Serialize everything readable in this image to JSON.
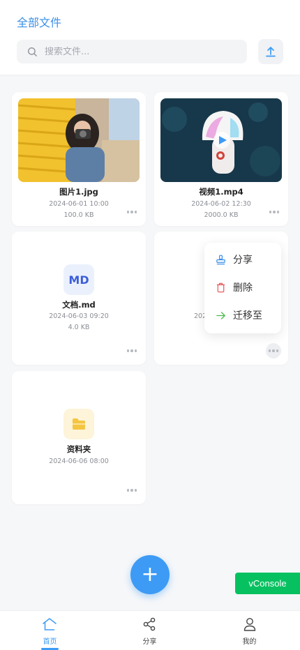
{
  "header": {
    "title": "全部文件",
    "search_placeholder": "搜索文件..."
  },
  "files": [
    {
      "name": "图片1.jpg",
      "date": "2024-06-01 10:00",
      "size": "100.0 KB",
      "type": "image"
    },
    {
      "name": "视频1.mp4",
      "date": "2024-06-02 12:30",
      "size": "2000.0 KB",
      "type": "video"
    },
    {
      "name": "文档.md",
      "date": "2024-06-03 09:20",
      "size": "4.0 KB",
      "type": "markdown",
      "icon_text": "MD"
    },
    {
      "name": "",
      "date": "202",
      "size": "",
      "type": "unknown"
    },
    {
      "name": "资料夹",
      "date": "2024-06-06 08:00",
      "size": "",
      "type": "folder"
    }
  ],
  "context_menu": {
    "items": [
      {
        "label": "分享",
        "icon": "share-stamp-icon",
        "color": "#3b8fe8"
      },
      {
        "label": "删除",
        "icon": "trash-icon",
        "color": "#e85a5a"
      },
      {
        "label": "迁移至",
        "icon": "arrow-right-icon",
        "color": "#4cb84c"
      }
    ]
  },
  "fab": {
    "label": "+"
  },
  "vconsole": {
    "label": "vConsole"
  },
  "tabbar": {
    "items": [
      {
        "label": "首页",
        "icon": "home-icon",
        "active": true
      },
      {
        "label": "分享",
        "icon": "share-nodes-icon",
        "active": false
      },
      {
        "label": "我的",
        "icon": "user-icon",
        "active": false
      }
    ]
  },
  "colors": {
    "accent": "#3d9bf5",
    "vconsole": "#07c160"
  }
}
